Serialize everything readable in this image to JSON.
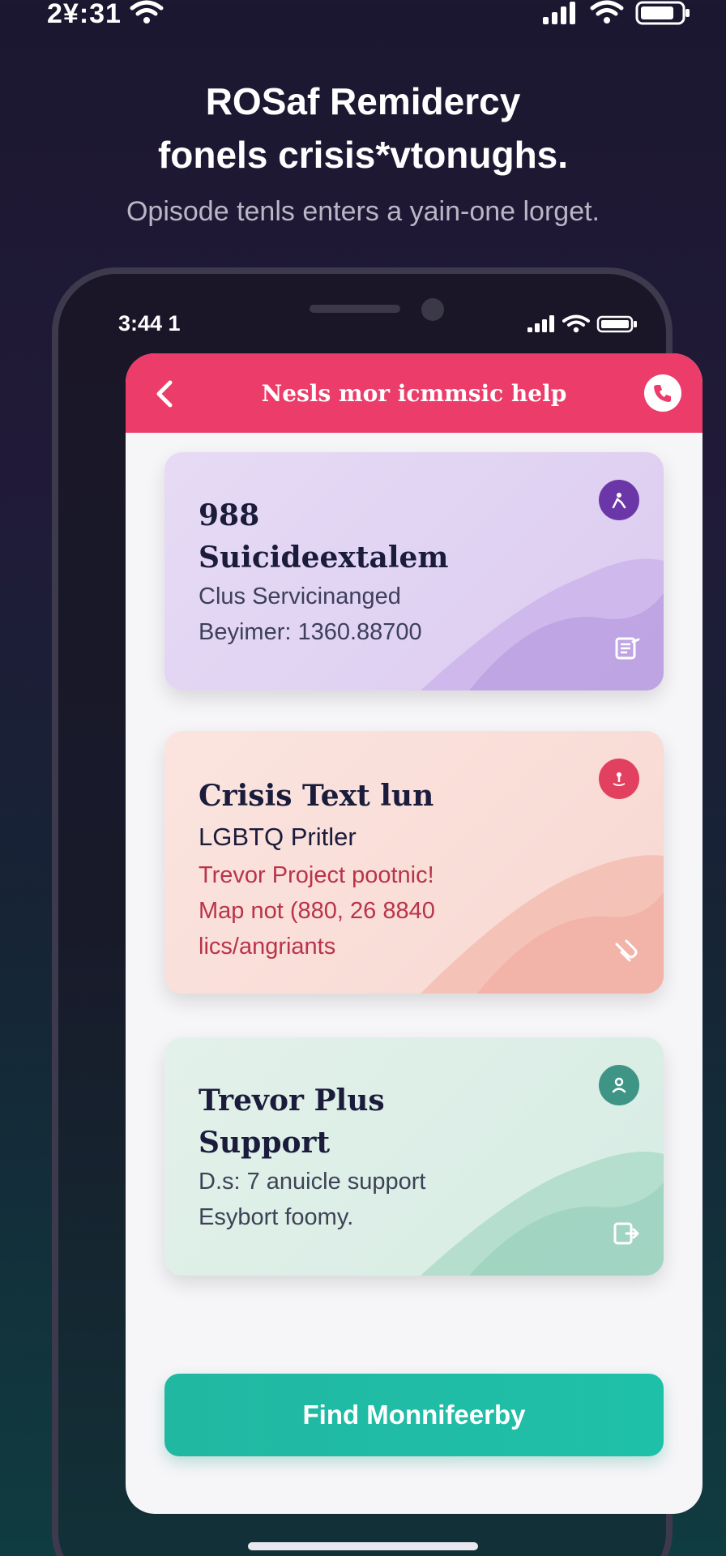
{
  "outer_status": {
    "time": "2¥:31"
  },
  "headline": {
    "line1": "ROSaf Remidercy",
    "line2": "fonels crisis*vtonughs.",
    "subline": "Opisode tenls enters a yain-one lorget."
  },
  "phone": {
    "inner_time": "3:44 1"
  },
  "app": {
    "header_title": "Nesls mor icmmsic help",
    "colors": {
      "header": "#ec3c6a",
      "cta": "#21b8a2"
    },
    "cards": [
      {
        "title_lines": [
          "988",
          "Suicideextalem"
        ],
        "sub_lines": [
          "Clus Servicinanged",
          "Beyimer: 1360.88700"
        ],
        "badge_icon": "person-icon",
        "corner_icon": "note-icon",
        "accent": "#6b37a8"
      },
      {
        "title_lines": [
          "Crisis Text lun"
        ],
        "subtitle": "LGBTQ Pritler",
        "sub_lines": [
          "Trevor Project pootnic!",
          "Map not (880, 26 8840",
          "lics/angriants"
        ],
        "badge_icon": "hand-icon",
        "corner_icon": "link-icon",
        "accent": "#e2405f"
      },
      {
        "title_lines": [
          "Trevor Plus",
          "Support"
        ],
        "sub_lines": [
          "D.s: 7 anuicle support",
          "Esybort foomy."
        ],
        "badge_icon": "user-icon",
        "corner_icon": "exit-icon",
        "accent": "#3e9585"
      }
    ],
    "cta_label": "Find Monnifeerby"
  }
}
